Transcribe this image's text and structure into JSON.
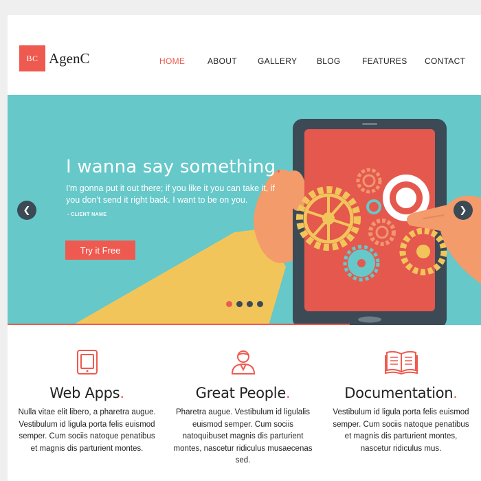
{
  "brand": {
    "logo_mark": "BC",
    "name": "AgenC",
    "accent": "#ee5a4f"
  },
  "nav": {
    "items": [
      {
        "label": "HOME",
        "active": true
      },
      {
        "label": "ABOUT"
      },
      {
        "label": "GALLERY"
      },
      {
        "label": "BLOG"
      },
      {
        "label": "FEATURES"
      },
      {
        "label": "CONTACT"
      }
    ]
  },
  "hero": {
    "title": "I wanna say something",
    "title_dot": ".",
    "text": "I'm gonna put it out there; if you like it you can take it, if you don't send it right back. I want to be on you.",
    "author": "- CLIENT NAME",
    "cta": "Try it Free",
    "prev_icon": "chevron-left-icon",
    "next_icon": "chevron-right-icon",
    "slides_count": 4,
    "active_slide": 1,
    "background": "#66c8c9"
  },
  "features": [
    {
      "icon": "tablet-icon",
      "title": "Web Apps",
      "dot": ".",
      "text": "Nulla vitae elit libero, a pharetra augue. Vestibulum id ligula porta felis euismod semper. Cum sociis natoque penatibus et magnis dis parturient montes."
    },
    {
      "icon": "person-icon",
      "title": "Great People",
      "dot": ".",
      "text": "Pharetra augue. Vestibulum id ligulalis euismod semper. Cum sociis natoquibuset magnis dis parturient montes, nascetur ridiculus musaecenas sed."
    },
    {
      "icon": "open-book-icon",
      "title": "Documentation",
      "dot": ".",
      "text": "Vestibulum id ligula porta felis euismod semper. Cum sociis natoque penatibus et magnis dis parturient montes, nascetur ridiculus mus."
    }
  ]
}
